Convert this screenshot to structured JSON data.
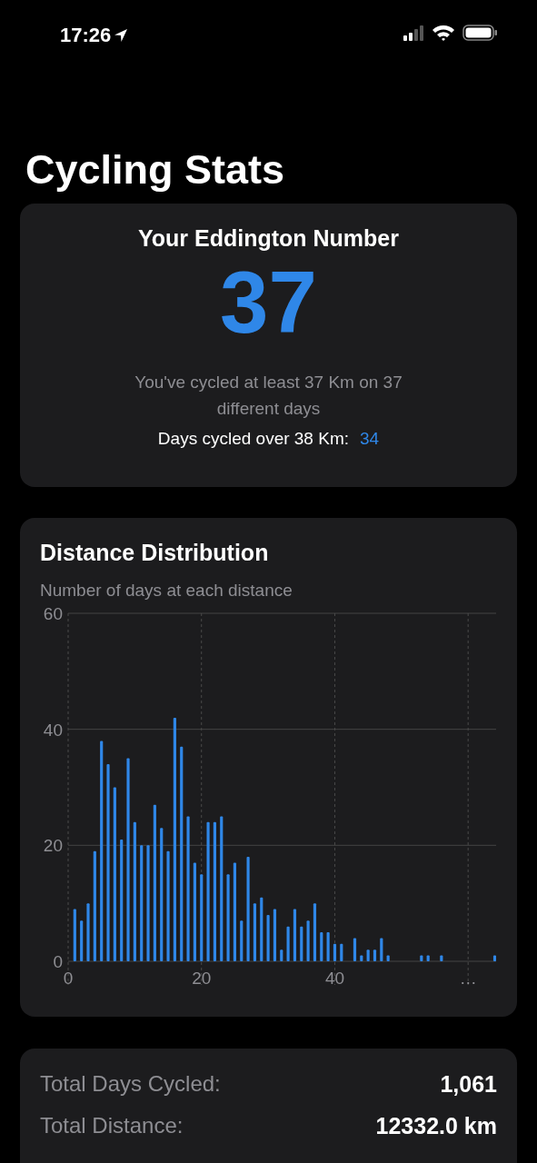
{
  "status_bar": {
    "time": "17:26"
  },
  "title": "Cycling Stats",
  "eddington": {
    "heading": "Your Eddington Number",
    "number": "37",
    "description": "You've cycled at least 37 Km on 37 different days",
    "next_label": "Days cycled over 38 Km:",
    "next_value": "34"
  },
  "distribution": {
    "title": "Distance Distribution",
    "subtitle": "Number of days at each distance",
    "chart_data": {
      "type": "bar",
      "x": [
        1,
        2,
        3,
        4,
        5,
        6,
        7,
        8,
        9,
        10,
        11,
        12,
        13,
        14,
        15,
        16,
        17,
        18,
        19,
        20,
        21,
        22,
        23,
        24,
        25,
        26,
        27,
        28,
        29,
        30,
        31,
        32,
        33,
        34,
        35,
        36,
        37,
        38,
        39,
        40,
        41,
        43,
        44,
        45,
        46,
        47,
        48,
        53,
        54,
        56,
        64
      ],
      "values": [
        9,
        7,
        10,
        19,
        38,
        34,
        30,
        21,
        35,
        24,
        20,
        20,
        27,
        23,
        19,
        42,
        37,
        25,
        17,
        15,
        24,
        24,
        25,
        15,
        17,
        7,
        18,
        10,
        11,
        8,
        9,
        2,
        6,
        9,
        6,
        7,
        10,
        5,
        5,
        3,
        3,
        4,
        1,
        2,
        2,
        4,
        1,
        1,
        1,
        1,
        1
      ],
      "xlim": [
        0,
        64.2
      ],
      "ylim": [
        0,
        60
      ],
      "xticks": [
        0,
        20,
        40,
        {
          "value": 60,
          "label": "…"
        }
      ],
      "yticks": [
        0,
        20,
        40,
        60
      ],
      "grid": true
    }
  },
  "totals": [
    {
      "label": "Total Days Cycled:",
      "value": "1,061"
    },
    {
      "label": "Total Distance:",
      "value": "12332.0 km"
    }
  ]
}
